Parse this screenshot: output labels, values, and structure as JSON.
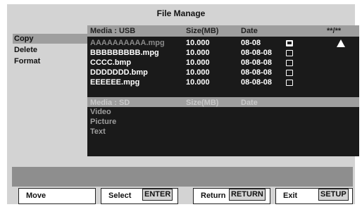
{
  "title": "File Manage",
  "menu": [
    "Copy",
    "Delete",
    "Format"
  ],
  "usb": {
    "header": {
      "media": "Media : USB",
      "size": "Size(MB)",
      "date": "Date",
      "page": "**/**"
    },
    "files": [
      {
        "name": "AAAAAAAAAA.mpg",
        "size": "10.000",
        "date": "08-08",
        "checked": true
      },
      {
        "name": "BBBBBBBBB.mpg",
        "size": "10.000",
        "date": "08-08-08",
        "checked": false
      },
      {
        "name": "CCCC.bmp",
        "size": "10.000",
        "date": "08-08-08",
        "checked": false
      },
      {
        "name": "DDDDDDD.bmp",
        "size": "10.000",
        "date": "08-08-08",
        "checked": false
      },
      {
        "name": "EEEEEE.mpg",
        "size": "10.000",
        "date": "08-08-08",
        "checked": false
      }
    ]
  },
  "sd": {
    "header": {
      "media": "Media : SD",
      "size": "Size(MB)",
      "date": "Date"
    },
    "folders": [
      "Video",
      "Picture",
      "Text"
    ]
  },
  "buttons": [
    {
      "label": "Move",
      "key": ""
    },
    {
      "label": "Select",
      "key": "ENTER"
    },
    {
      "label": "Return",
      "key": "RETURN"
    },
    {
      "label": "Exit",
      "key": "SETUP"
    }
  ]
}
